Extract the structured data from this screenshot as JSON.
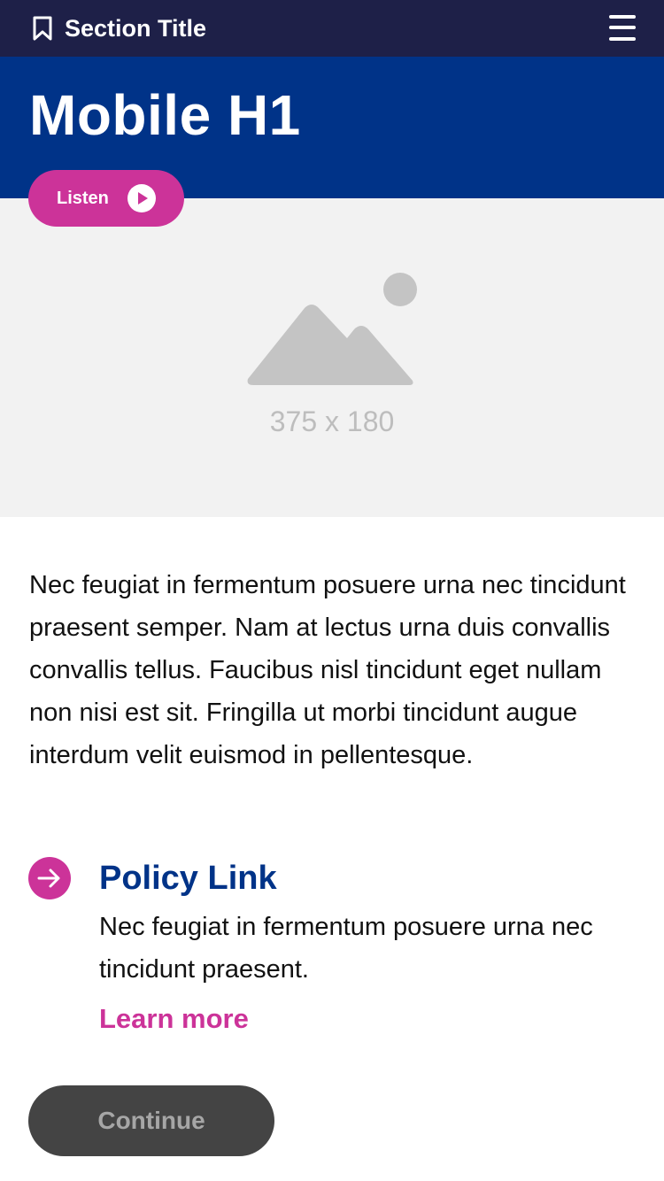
{
  "header": {
    "section_title": "Section Title",
    "bookmark_icon": "bookmark-icon",
    "menu_icon": "hamburger-menu-icon"
  },
  "hero": {
    "title": "Mobile H1",
    "listen_label": "Listen",
    "play_icon": "play-icon"
  },
  "image_placeholder": {
    "icon": "image-placeholder-icon",
    "dimensions_text": "375 x 180"
  },
  "body": {
    "paragraph": "Nec feugiat in fermentum posuere urna nec tincidunt praesent semper. Nam at lectus urna duis convallis convallis tellus. Faucibus nisl tincidunt eget nullam non nisi est sit. Fringilla ut morbi tincidunt augue interdum velit euismod in pellentesque."
  },
  "policy": {
    "arrow_icon": "arrow-right-icon",
    "title": "Policy Link",
    "description": "Nec feugiat in fermentum posuere urna nec tincidunt praesent.",
    "learn_more": "Learn more"
  },
  "actions": {
    "continue_label": "Continue"
  },
  "colors": {
    "header_bg": "#1e2048",
    "hero_bg": "#003388",
    "accent": "#cc3399",
    "image_bg": "#f2f2f2",
    "button_disabled_bg": "#444444"
  }
}
